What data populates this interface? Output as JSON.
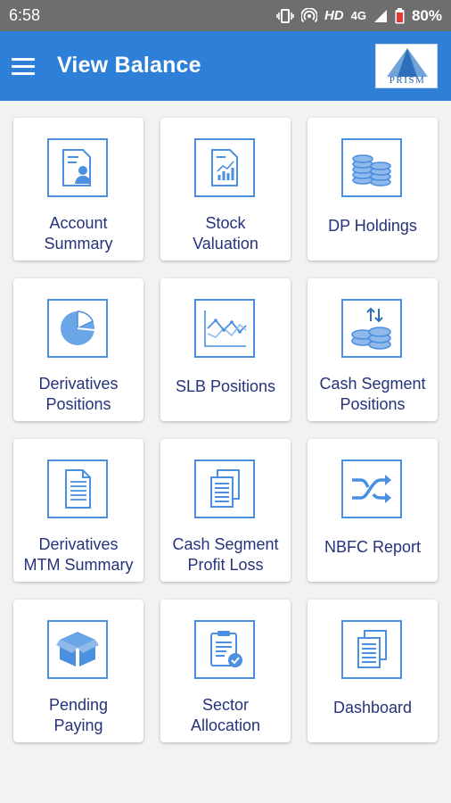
{
  "status_bar": {
    "time": "6:58",
    "network": "HD",
    "signal": "4G",
    "battery": "80%"
  },
  "app_bar": {
    "title": "View Balance",
    "logo_text": "PRISM"
  },
  "colors": {
    "app_bar": "#2d7fd8",
    "icon_stroke": "#4a8fe0",
    "label": "#26327a",
    "status_bar": "#6e6e6e"
  },
  "tiles": [
    {
      "label": "Account\nSummary",
      "icon": "account-summary-icon"
    },
    {
      "label": "Stock\nValuation",
      "icon": "stock-valuation-icon"
    },
    {
      "label": "DP Holdings",
      "icon": "coins-stack-icon"
    },
    {
      "label": "Derivatives\nPositions",
      "icon": "pie-chart-icon"
    },
    {
      "label": "SLB Positions",
      "icon": "line-chart-icon"
    },
    {
      "label": "Cash Segment\nPositions",
      "icon": "coins-exchange-icon"
    },
    {
      "label": "Derivatives\nMTM Summary",
      "icon": "document-icon"
    },
    {
      "label": "Cash Segment\nProfit Loss",
      "icon": "documents-icon"
    },
    {
      "label": "NBFC Report",
      "icon": "shuffle-icon"
    },
    {
      "label": "Pending\nPaying",
      "icon": "box-icon"
    },
    {
      "label": "Sector\nAllocation",
      "icon": "clipboard-check-icon"
    },
    {
      "label": "Dashboard",
      "icon": "dashboard-documents-icon"
    }
  ]
}
